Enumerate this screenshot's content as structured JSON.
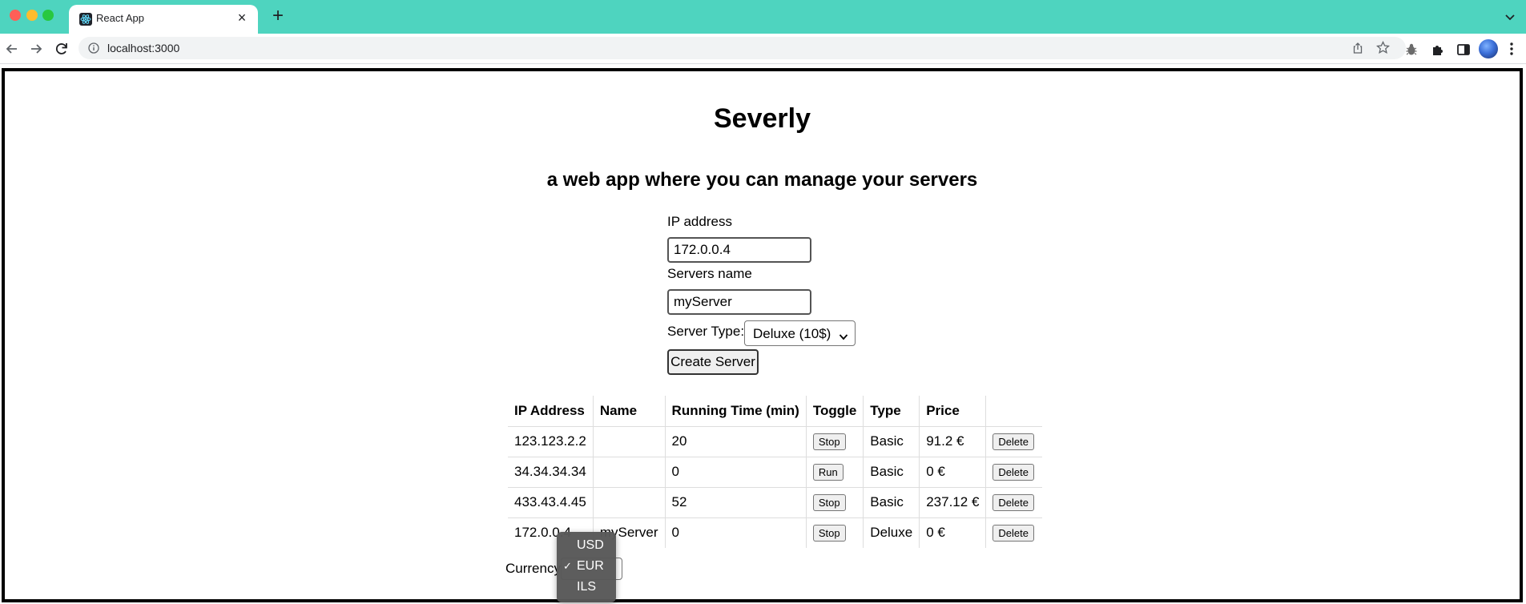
{
  "browser": {
    "tab_title": "React App",
    "tab_close": "×",
    "new_tab": "+",
    "url": "localhost:3000"
  },
  "app": {
    "title": "Severly",
    "subtitle": "a web app where you can manage your servers"
  },
  "form": {
    "ip_label": "IP address",
    "ip_value": "172.0.0.4",
    "name_label": "Servers name",
    "name_value": "myServer",
    "type_label": "Server Type:",
    "type_selected": "Deluxe (10$)",
    "create_button": "Create Server"
  },
  "table": {
    "headers": [
      "IP Address",
      "Name",
      "Running Time (min)",
      "Toggle",
      "Type",
      "Price",
      ""
    ],
    "rows": [
      {
        "ip": "123.123.2.2",
        "name": "",
        "running_time": "20",
        "toggle": "Stop",
        "type": "Basic",
        "price": "91.2 €",
        "action": "Delete"
      },
      {
        "ip": "34.34.34.34",
        "name": "",
        "running_time": "0",
        "toggle": "Run",
        "type": "Basic",
        "price": "0 €",
        "action": "Delete"
      },
      {
        "ip": "433.43.4.45",
        "name": "",
        "running_time": "52",
        "toggle": "Stop",
        "type": "Basic",
        "price": "237.12 €",
        "action": "Delete"
      },
      {
        "ip": "172.0.0.4",
        "name": "myServer",
        "running_time": "0",
        "toggle": "Stop",
        "type": "Deluxe",
        "price": "0 €",
        "action": "Delete"
      }
    ]
  },
  "currency": {
    "label": "Currency",
    "options": [
      {
        "label": "USD",
        "selected": false
      },
      {
        "label": "EUR",
        "selected": true
      },
      {
        "label": "ILS",
        "selected": false
      }
    ],
    "check_mark": "✓"
  },
  "colors": {
    "tabbar": "#4ed4bf",
    "frame_border": "#000000",
    "dropdown_bg": "#585858"
  }
}
